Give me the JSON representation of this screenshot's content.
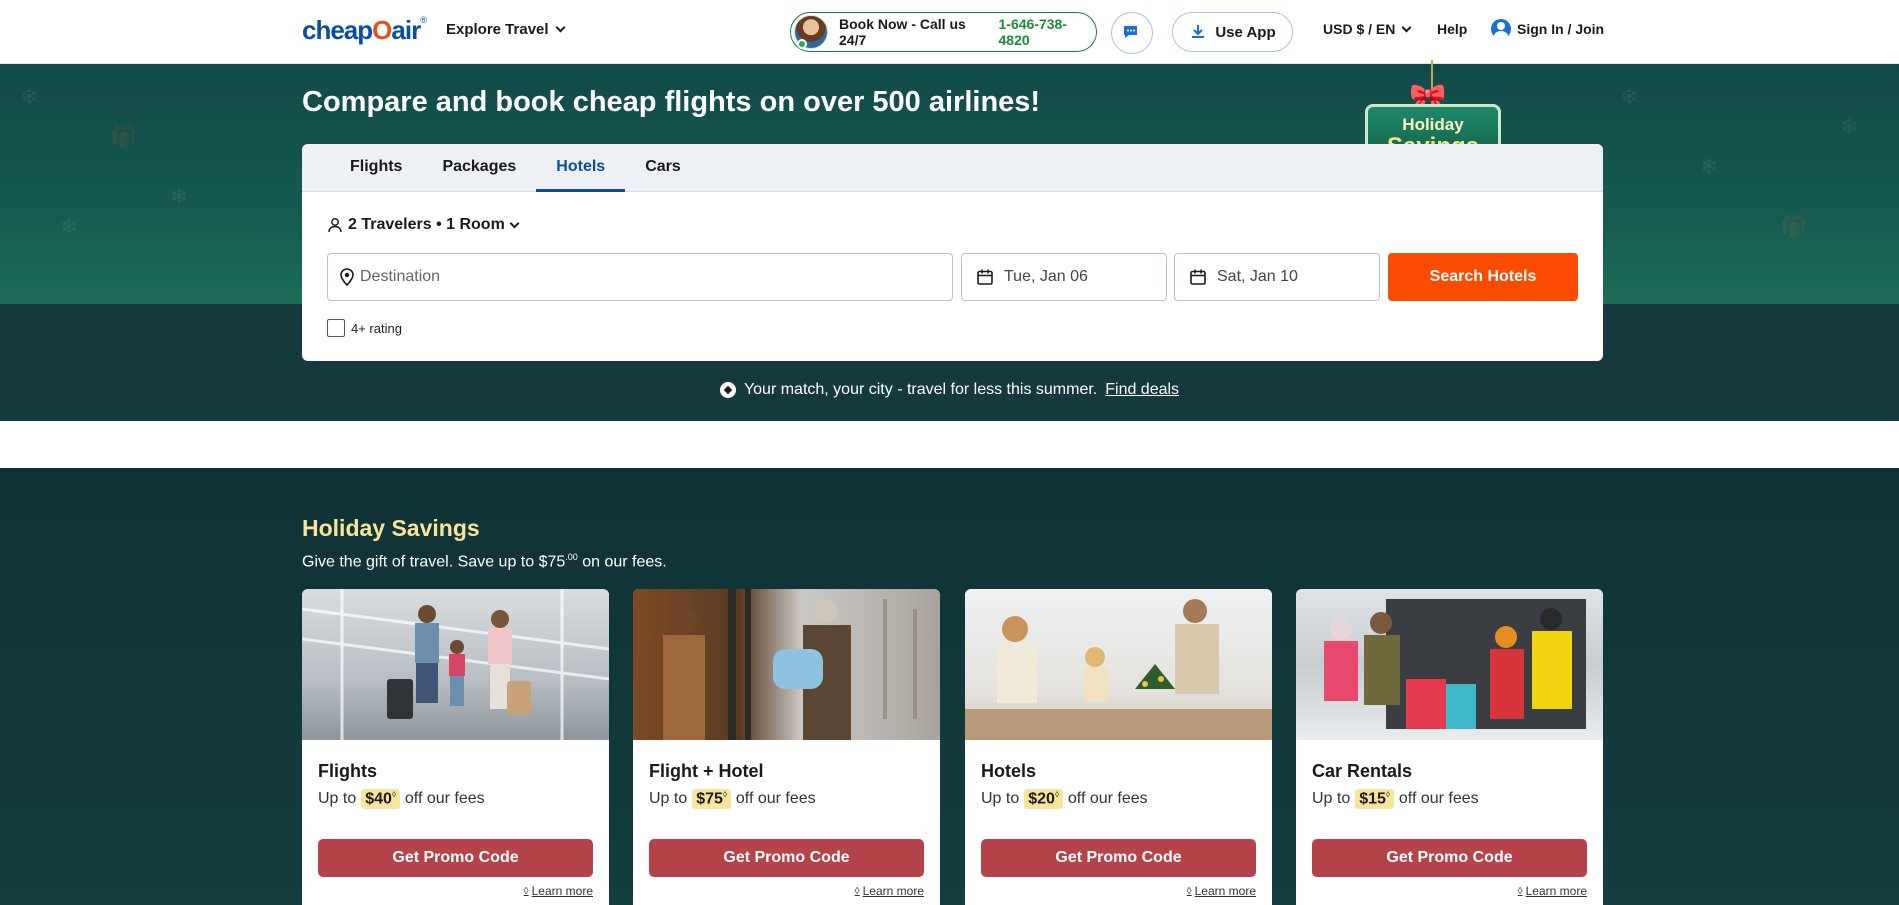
{
  "header": {
    "logo_text": "cheapOair",
    "explore_label": "Explore Travel",
    "book_now_label": "Book Now - Call us 24/7",
    "phone": "1-646-738-4820",
    "use_app_label": "Use App",
    "currency_label": "USD $ / EN",
    "help_label": "Help",
    "signin_label": "Sign In / Join"
  },
  "hero": {
    "title": "Compare and book cheap flights on over 500 airlines!",
    "badge_line1": "Holiday",
    "badge_line2": "Savings"
  },
  "search": {
    "tabs": [
      {
        "label": "Flights",
        "active": false
      },
      {
        "label": "Packages",
        "active": false
      },
      {
        "label": "Hotels",
        "active": true
      },
      {
        "label": "Cars",
        "active": false
      }
    ],
    "travelers_label": "2 Travelers • 1 Room",
    "destination_placeholder": "Destination",
    "checkin": "Tue, Jan 06",
    "checkout": "Sat, Jan 10",
    "search_button": "Search Hotels",
    "rating_label": "4+ rating"
  },
  "promo_bar": {
    "text": "Your match, your city - travel for less this summer.",
    "link": "Find deals"
  },
  "holiday": {
    "title": "Holiday Savings",
    "subtitle_prefix": "Give the gift of travel. Save up to $75",
    "subtitle_cents": ".00",
    "subtitle_suffix": "on our fees.",
    "cards": [
      {
        "title": "Flights",
        "prefix": "Up to",
        "amount": "$40",
        "suffix": "off our fees",
        "button": "Get Promo Code",
        "learn": "Learn more"
      },
      {
        "title": "Flight + Hotel",
        "prefix": "Up to",
        "amount": "$75",
        "suffix": "off our fees",
        "button": "Get Promo Code",
        "learn": "Learn more"
      },
      {
        "title": "Hotels",
        "prefix": "Up to",
        "amount": "$20",
        "suffix": "off our fees",
        "button": "Get Promo Code",
        "learn": "Learn more"
      },
      {
        "title": "Car Rentals",
        "prefix": "Up to",
        "amount": "$15",
        "suffix": "off our fees",
        "button": "Get Promo Code",
        "learn": "Learn more"
      }
    ]
  },
  "colors": {
    "brand_blue": "#0a4ea3",
    "search_orange": "#fc4c02",
    "promo_button": "#b5434a",
    "holiday_gold": "#f7e59a"
  }
}
